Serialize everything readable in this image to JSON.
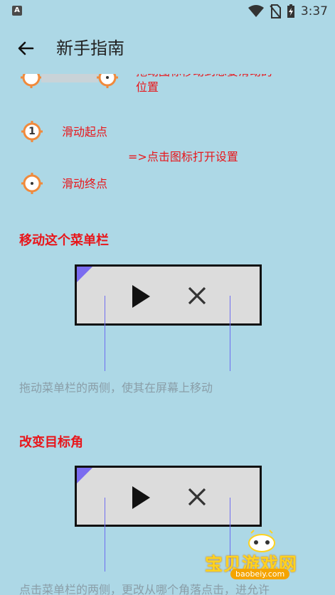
{
  "status_bar": {
    "notification_icon": "A",
    "time": "3:37",
    "icons": [
      "wifi-icon",
      "no-sim-icon",
      "battery-charging-icon"
    ]
  },
  "app_bar": {
    "title": "新手指南",
    "back_icon": "arrow-left-icon"
  },
  "guide": {
    "partial_top_text_line1": "拖动图标移动到想要滑动的",
    "partial_top_text_line2": "位置",
    "swipe_start_marker": "1",
    "swipe_start_label": "滑动起点",
    "open_settings_hint": "=>点击图标打开设置",
    "swipe_end_label": "滑动终点",
    "move_menu_heading": "移动这个菜单栏",
    "move_menu_caption": "拖动菜单栏的两侧，使其在屏幕上移动",
    "change_corner_heading": "改变目标角",
    "change_corner_caption": "点击菜单栏的两侧，更改从哪个角落点击，进允许"
  },
  "colors": {
    "background": "#add8e6",
    "accent_red": "#e8161b",
    "marker_orange": "#f08a3c",
    "corner_purple": "#7b6cf0",
    "guide_line": "#6e6ef0"
  },
  "watermark": {
    "text": "宝贝游戏网",
    "url": "baobeiy.com"
  }
}
